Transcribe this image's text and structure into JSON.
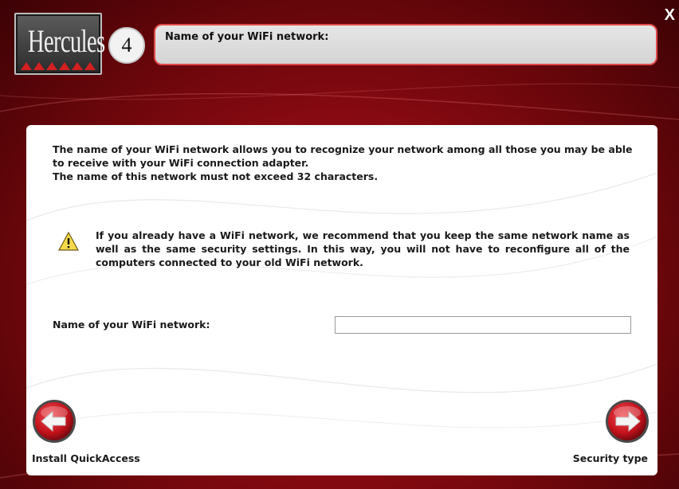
{
  "brand": {
    "logo_text": "Hercules"
  },
  "header": {
    "step_number": "4",
    "title": "Name of your WiFi network:",
    "close_label": "X"
  },
  "content": {
    "intro_line1": "The name of your WiFi network allows you to recognize your network among all those you may be able to receive with your WiFi connection adapter.",
    "intro_line2": "The name of this network must not exceed 32 characters.",
    "warning": "If you already have a WiFi network, we recommend that you keep the same network name as well as the same security settings. In this way, you will not have to reconfigure all of the computers connected to your old WiFi network.",
    "field_label": "Name of your WiFi network:",
    "field_value": ""
  },
  "nav": {
    "back_label": "Install QuickAccess",
    "next_label": "Security type"
  },
  "colors": {
    "background": "#8a0a12",
    "accent_border": "#e04a4a",
    "button_red": "#c3121c",
    "panel": "#ffffff"
  },
  "icons": {
    "warning": "warning-icon",
    "back": "arrow-left-icon",
    "next": "arrow-right-icon",
    "close": "close-icon"
  }
}
